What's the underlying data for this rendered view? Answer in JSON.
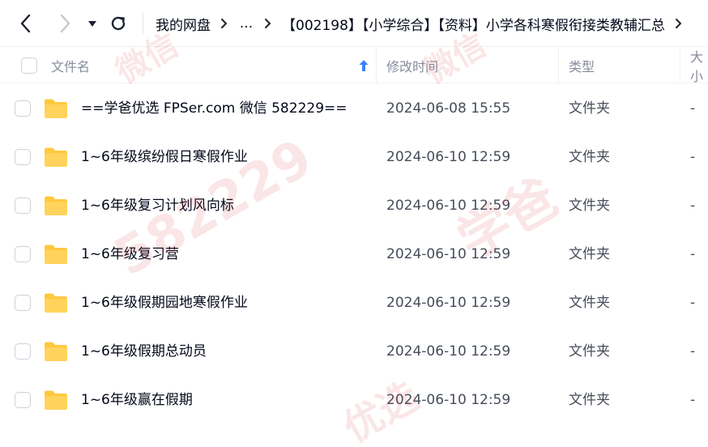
{
  "nav": {
    "back_icon": "chevron-left-icon",
    "forward_icon": "chevron-right-icon",
    "dropdown_icon": "caret-down-icon",
    "refresh_icon": "refresh-icon"
  },
  "breadcrumb": {
    "root": "我的网盘",
    "ellipsis": "...",
    "current": "【002198】【小学综合】【资料】小学各科寒假衔接类教辅汇总"
  },
  "columns": {
    "name": "文件名",
    "modified": "修改时间",
    "type": "类型",
    "size": "大小"
  },
  "files": [
    {
      "name": "==学爸优选 FPSer.com 微信 582229==",
      "modified": "2024-06-08 15:55",
      "type": "文件夹",
      "size": "-"
    },
    {
      "name": "1~6年级缤纷假日寒假作业",
      "modified": "2024-06-10 12:59",
      "type": "文件夹",
      "size": "-"
    },
    {
      "name": "1~6年级复习计划风向标",
      "modified": "2024-06-10 12:59",
      "type": "文件夹",
      "size": "-"
    },
    {
      "name": "1~6年级复习营",
      "modified": "2024-06-10 12:59",
      "type": "文件夹",
      "size": "-"
    },
    {
      "name": "1~6年级假期园地寒假作业",
      "modified": "2024-06-10 12:59",
      "type": "文件夹",
      "size": "-"
    },
    {
      "name": "1~6年级假期总动员",
      "modified": "2024-06-10 12:59",
      "type": "文件夹",
      "size": "-"
    },
    {
      "name": "1~6年级赢在假期",
      "modified": "2024-06-10 12:59",
      "type": "文件夹",
      "size": "-"
    }
  ],
  "watermark": {
    "line1": "微信",
    "line2": "学爸",
    "line3": "582229",
    "line4": "优选"
  },
  "colors": {
    "folder": "#ffc83d",
    "sort_arrow": "#3b82f6",
    "watermark": "#d7323c"
  }
}
